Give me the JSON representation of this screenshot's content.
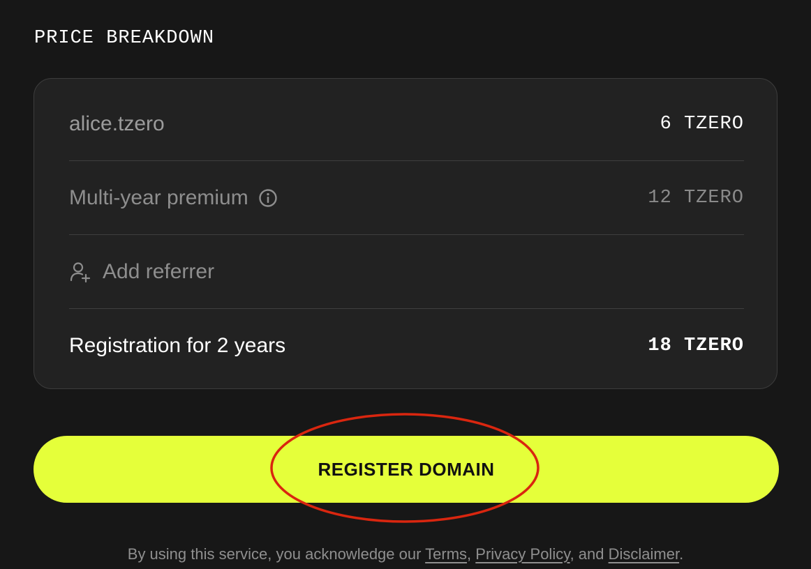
{
  "section_title": "PRICE BREAKDOWN",
  "breakdown": {
    "domain": {
      "label": "alice.tzero",
      "value": "6 TZERO"
    },
    "premium": {
      "label": "Multi-year premium",
      "value": "12 TZERO"
    },
    "referrer": {
      "label": "Add referrer"
    },
    "total": {
      "label": "Registration for 2 years",
      "value": "18 TZERO"
    }
  },
  "cta": {
    "label": "REGISTER DOMAIN"
  },
  "legal": {
    "prefix": "By using this service, you acknowledge our ",
    "terms": "Terms",
    "sep1": ", ",
    "privacy": "Privacy Policy",
    "sep2": ", and ",
    "disclaimer": "Disclaimer",
    "suffix": "."
  },
  "colors": {
    "background": "#171717",
    "card": "#222222",
    "accent": "#e5ff3a",
    "highlight": "#d9260f"
  },
  "icons": {
    "info": "info-circle-icon",
    "referrer": "person-add-icon"
  }
}
